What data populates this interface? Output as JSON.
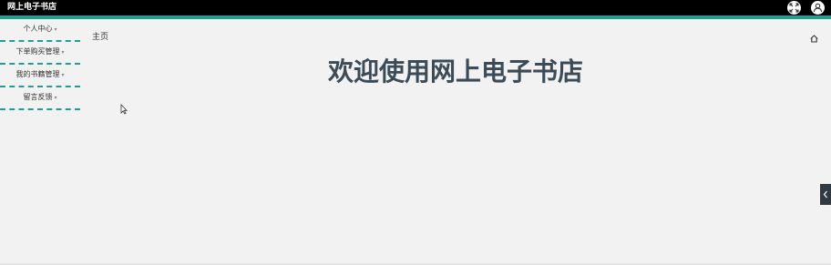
{
  "header": {
    "app_title": "网上电子书店",
    "fullscreen_icon": "expand-icon",
    "user_icon": "user-icon"
  },
  "sidebar": {
    "items": [
      {
        "label": "个人中心"
      },
      {
        "label": "下单购买管理"
      },
      {
        "label": "我的书籍管理"
      },
      {
        "label": "留言反馈"
      }
    ]
  },
  "breadcrumb": {
    "home_label": "主页"
  },
  "main": {
    "welcome_text": "欢迎使用网上电子书店"
  },
  "colors": {
    "topbar": "#000000",
    "accent": "#1aa094",
    "welcome_text": "#3c4b58"
  }
}
